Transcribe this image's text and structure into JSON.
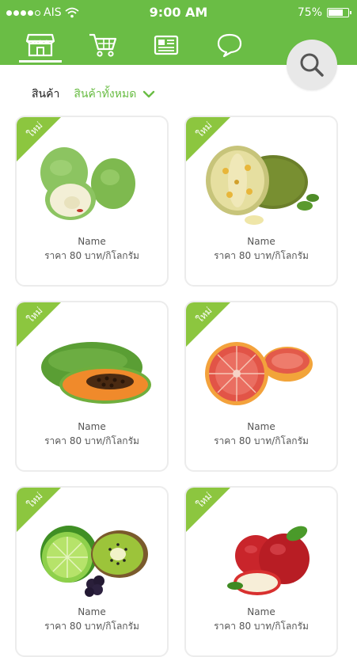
{
  "status": {
    "carrier": "AIS",
    "time": "9:00 AM",
    "battery_percent": "75%",
    "battery_level": 0.75,
    "signal_bars_filled": 4,
    "signal_bars_total": 5
  },
  "nav": {
    "tabs": [
      {
        "icon": "store-icon",
        "active": true
      },
      {
        "icon": "cart-icon",
        "active": false
      },
      {
        "icon": "news-icon",
        "active": false
      },
      {
        "icon": "chat-icon",
        "active": false
      }
    ]
  },
  "search": {
    "icon": "search-icon"
  },
  "filter": {
    "label": "สินค้า",
    "selected": "สินค้าทั้งหมด"
  },
  "colors": {
    "brand": "#6abd45"
  },
  "products": [
    {
      "badge": "ใหม่",
      "name": "Name",
      "price": "ราคา 80 บาท/กิโลกรัม",
      "image": "guava"
    },
    {
      "badge": "ใหม่",
      "name": "Name",
      "price": "ราคา 80 บาท/กิโลกรัม",
      "image": "jackfruit"
    },
    {
      "badge": "ใหม่",
      "name": "Name",
      "price": "ราคา 80 บาท/กิโลกรัม",
      "image": "papaya"
    },
    {
      "badge": "ใหม่",
      "name": "Name",
      "price": "ราคา 80 บาท/กิโลกรัม",
      "image": "grapefruit"
    },
    {
      "badge": "ใหม่",
      "name": "Name",
      "price": "ราคา 80 บาท/กิโลกรัม",
      "image": "lime-kiwi-blackberry"
    },
    {
      "badge": "ใหม่",
      "name": "Name",
      "price": "ราคา 80 บาท/กิโลกรัม",
      "image": "apple"
    }
  ]
}
